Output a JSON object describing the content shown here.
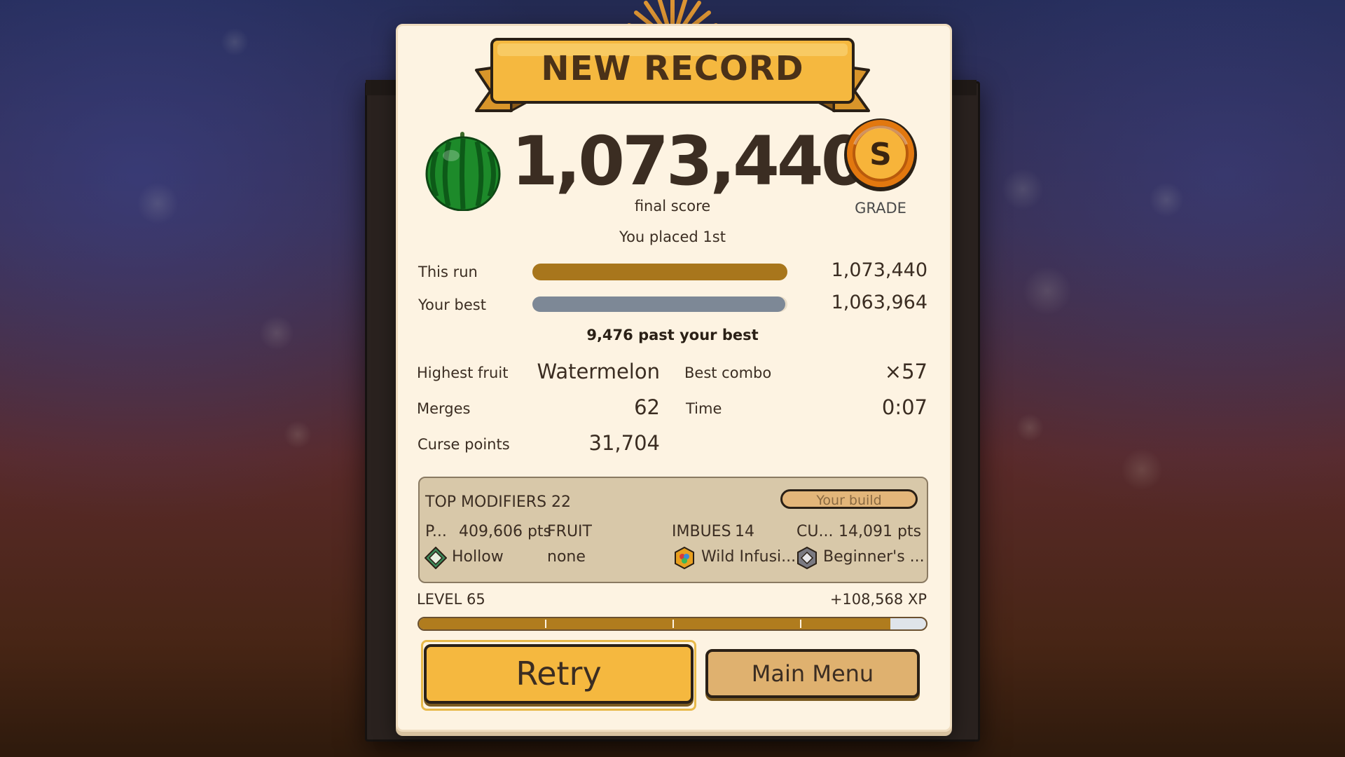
{
  "banner": {
    "title": "NEW RECORD"
  },
  "score": {
    "value": "1,073,440",
    "label": "final score"
  },
  "grade": {
    "letter": "S",
    "label": "GRADE"
  },
  "placement": "You placed 1st",
  "comparison": {
    "this_run": {
      "label": "This run",
      "value": "1,073,440",
      "color": "#a8761c",
      "fill_fraction": 1.0
    },
    "your_best": {
      "label": "Your best",
      "value": "1,063,964",
      "color": "#7d8896",
      "fill_fraction": 0.991
    },
    "delta": "9,476 past your best"
  },
  "stats": {
    "highest_fruit": {
      "label": "Highest fruit",
      "value": "Watermelon"
    },
    "best_combo": {
      "label": "Best combo",
      "value": "×57"
    },
    "merges": {
      "label": "Merges",
      "value": "62"
    },
    "time": {
      "label": "Time",
      "value": "0:07"
    },
    "curse_points": {
      "label": "Curse points",
      "value": "31,704"
    }
  },
  "modifiers": {
    "title": "TOP MODIFIERS",
    "count": "22",
    "build_button": "Your build",
    "col1": {
      "header": "P...",
      "pts": "409,606 pts",
      "item": "Hollow",
      "icon": "green-gem-icon"
    },
    "col2": {
      "header": "FRUIT",
      "item": "none"
    },
    "col3": {
      "header": "IMBUES",
      "count": "14",
      "item": "Wild Infusi...",
      "icon": "rainbow-gem-icon"
    },
    "col4": {
      "header": "CU...",
      "pts": "14,091 pts",
      "item": "Beginner's ...",
      "icon": "gray-gem-icon"
    }
  },
  "level": {
    "label": "LEVEL 65",
    "xp_gain": "+108,568 XP",
    "progress": 0.93
  },
  "buttons": {
    "retry": "Retry",
    "main_menu": "Main Menu"
  },
  "colors": {
    "panel": "#fdf3e2",
    "banner": "#f5b83f",
    "accent": "#a8761c"
  }
}
